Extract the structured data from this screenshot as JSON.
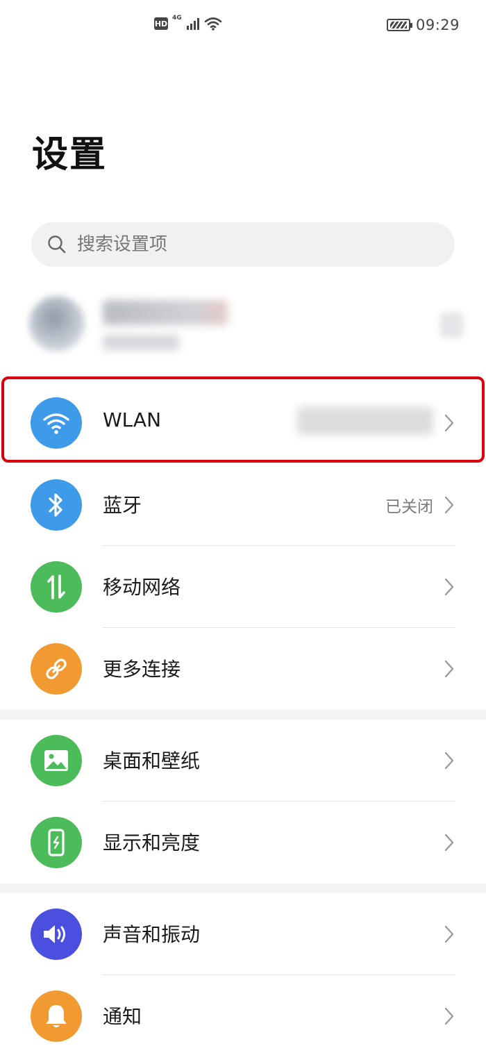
{
  "status_bar": {
    "hd_badge": "HD",
    "network_label": "4G",
    "time": "09:29"
  },
  "page": {
    "title": "设置"
  },
  "search": {
    "placeholder": "搜索设置项"
  },
  "settings_groups": [
    {
      "items": [
        {
          "label": "WLAN",
          "value": "",
          "icon": "wifi-icon",
          "icon_color": "#3d9be9",
          "highlighted": true
        },
        {
          "label": "蓝牙",
          "value": "已关闭",
          "icon": "bluetooth-icon",
          "icon_color": "#3d9be9"
        },
        {
          "label": "移动网络",
          "value": "",
          "icon": "mobile-data-icon",
          "icon_color": "#4cbb5a"
        },
        {
          "label": "更多连接",
          "value": "",
          "icon": "link-icon",
          "icon_color": "#f19a31"
        }
      ]
    },
    {
      "items": [
        {
          "label": "桌面和壁纸",
          "value": "",
          "icon": "wallpaper-icon",
          "icon_color": "#4cbb5a"
        },
        {
          "label": "显示和亮度",
          "value": "",
          "icon": "display-icon",
          "icon_color": "#4cbb5a"
        }
      ]
    },
    {
      "items": [
        {
          "label": "声音和振动",
          "value": "",
          "icon": "sound-icon",
          "icon_color": "#4a4fe0"
        },
        {
          "label": "通知",
          "value": "",
          "icon": "bell-icon",
          "icon_color": "#f19a31"
        }
      ]
    }
  ],
  "colors": {
    "highlight_border": "#d8000f",
    "chevron": "#9a9a9a"
  }
}
